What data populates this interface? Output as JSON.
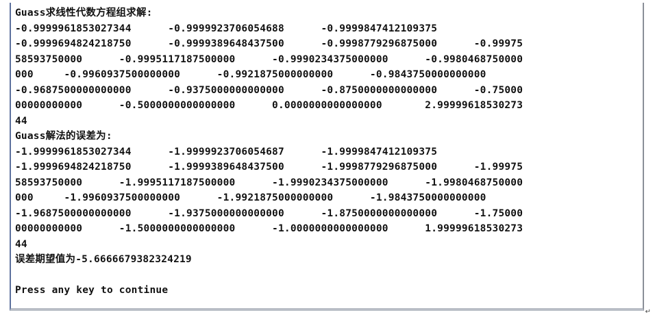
{
  "console": {
    "lines": [
      "Guass求线性代数方程组求解:",
      "-0.9999961853027344      -0.9999923706054688      -0.9999847412109375",
      "-0.9999694824218750      -0.9999389648437500      -0.9998779296875000      -0.99975",
      "58593750000      -0.9995117187500000      -0.9990234375000000      -0.9980468750000",
      "000     -0.9960937500000000      -0.9921875000000000      -0.9843750000000000",
      "-0.9687500000000000      -0.9375000000000000      -0.8750000000000000      -0.75000",
      "00000000000      -0.5000000000000000      0.0000000000000000       2.99999618530273",
      "44",
      "Guass解法的误差为:",
      "-1.9999961853027344      -1.9999923706054687      -1.9999847412109375",
      "-1.9999694824218750      -1.9999389648437500      -1.9998779296875000      -1.99975",
      "58593750000      -1.9995117187500000      -1.9990234375000000      -1.9980468750000",
      "000     -1.9960937500000000      -1.9921875000000000      -1.9843750000000000",
      "-1.9687500000000000      -1.9375000000000000      -1.8750000000000000      -1.75000",
      "00000000000      -1.5000000000000000      -1.0000000000000000      1.99999618530273",
      "44",
      "误差期望值为-5.6666679382324219",
      "",
      "Press any key to continue"
    ]
  }
}
